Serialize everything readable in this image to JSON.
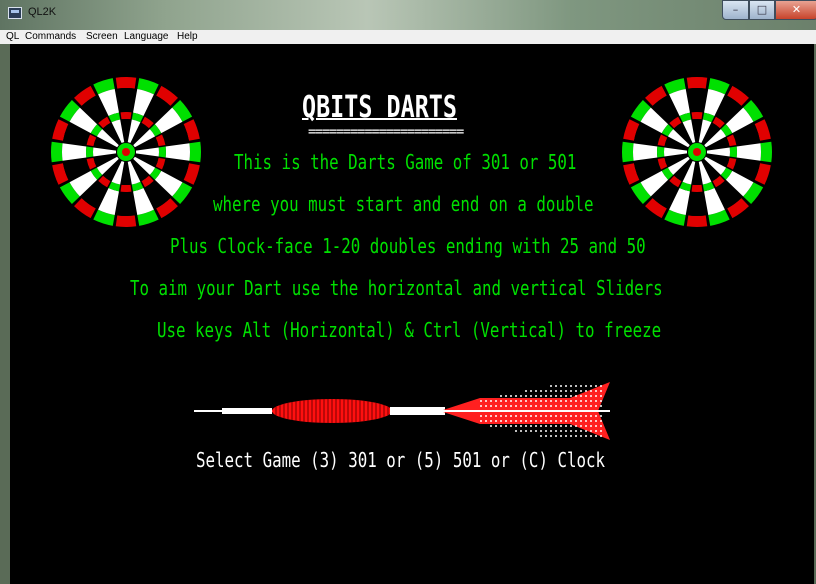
{
  "window": {
    "title": "QL2K"
  },
  "menu": [
    "QL",
    "Commands",
    "Screen",
    "Language",
    "Help"
  ],
  "screen": {
    "heading": "QBITS DARTS",
    "underline": "======================",
    "lines": [
      "This is the Darts Game of 301 or 501",
      "where you must start and end on a double",
      "Plus Clock-face 1-20 doubles ending with 25 and 50",
      "To aim your Dart use the horizontal and vertical Sliders",
      "Use keys Alt (Horizontal) & Ctrl (Vertical) to freeze"
    ],
    "prompt": "Select Game (3) 301 or (5) 501 or (C) Clock"
  },
  "colors": {
    "screen_bg": "#000000",
    "text_green": "#00e000",
    "text_white": "#ffffff",
    "board_red": "#e00000",
    "board_green": "#00e000"
  },
  "icons": [
    "dartboard-left-icon",
    "dartboard-right-icon",
    "dart-icon"
  ]
}
